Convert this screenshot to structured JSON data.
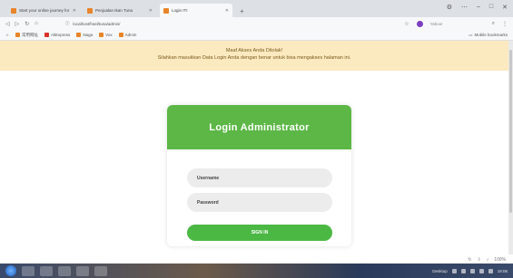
{
  "browser": {
    "tabs": [
      {
        "label": "Start your online journey for i",
        "active": false
      },
      {
        "label": "Penjualan Ikan Tuna",
        "active": false
      },
      {
        "label": "Login ITI",
        "active": true
      }
    ],
    "address": "localhost/hsel/tuna/admin/",
    "search_placeholder": "Yahoo!",
    "bookmarks": [
      "常用网址",
      "AliExpress",
      "Naga",
      "Vox",
      "Admin"
    ],
    "mobile_bookmarks": "Mobile bookmarks"
  },
  "alert": {
    "title": "Maaf Akses Anda Ditolak!",
    "message": "Silahkan masukkan Data Login Anda dengan benar untuk bisa mengakses halaman ini."
  },
  "login": {
    "title": "Login Administrator",
    "username_placeholder": "Username",
    "password_placeholder": "Password",
    "button": "SIGN IN"
  },
  "status_bar": {
    "zoom": "100%"
  },
  "taskbar": {
    "tray_text": "Desktop",
    "time": "18:06"
  },
  "colors": {
    "header_green": "#5cb746",
    "button_green": "#4cb844",
    "alert_bg": "#fbe9bf",
    "alert_text": "#7a5b1e"
  }
}
